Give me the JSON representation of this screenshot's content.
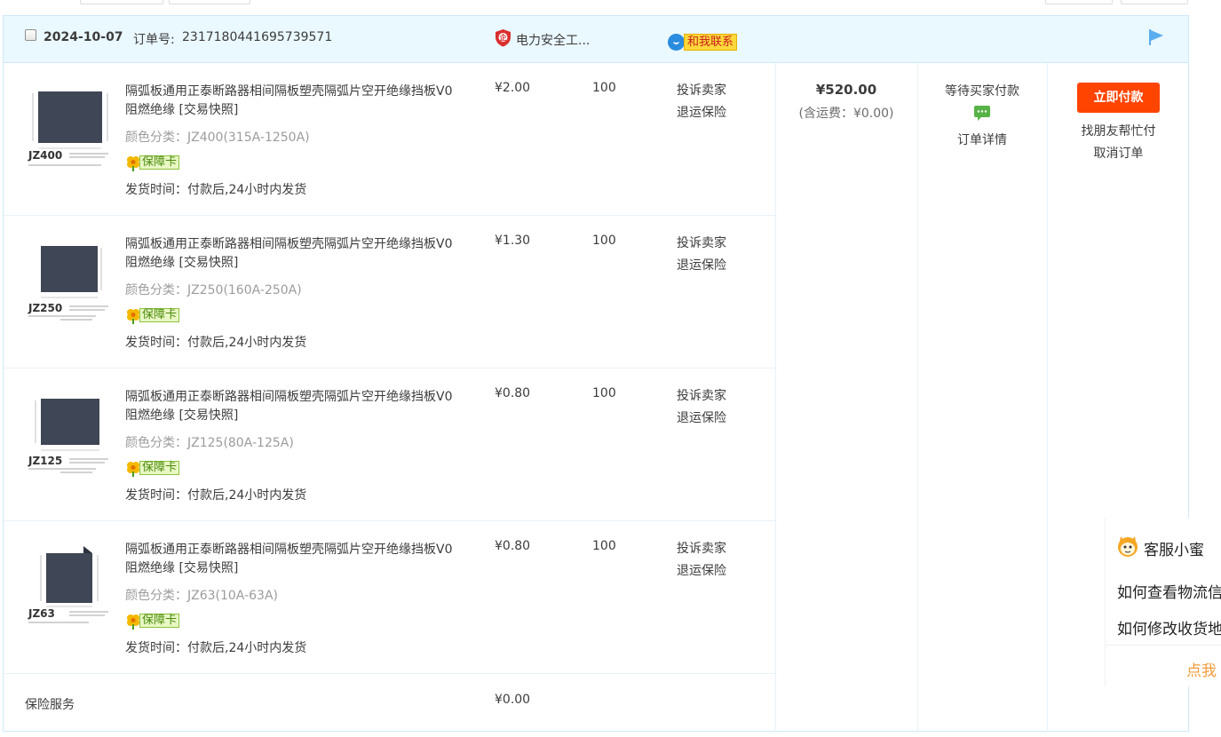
{
  "order": {
    "date": "2024-10-07",
    "order_no_label": "订单号:",
    "order_no": "2317180441695739571",
    "shop_name": "电力安全工...",
    "contact_label": "和我联系"
  },
  "items": [
    {
      "title": "隔弧板通用正泰断路器相间隔板塑壳隔弧片空开绝缘挡板V0阻燃绝缘 [交易快照]",
      "spec": "颜色分类：JZ400(315A-1250A)",
      "thumb_label": "JZ400",
      "badge": "保障卡",
      "ship": "发货时间：付款后,24小时内发货",
      "price": "¥2.00",
      "qty": "100",
      "op1": "投诉卖家",
      "op2": "退运保险"
    },
    {
      "title": "隔弧板通用正泰断路器相间隔板塑壳隔弧片空开绝缘挡板V0阻燃绝缘 [交易快照]",
      "spec": "颜色分类：JZ250(160A-250A)",
      "thumb_label": "JZ250",
      "badge": "保障卡",
      "ship": "发货时间：付款后,24小时内发货",
      "price": "¥1.30",
      "qty": "100",
      "op1": "投诉卖家",
      "op2": "退运保险"
    },
    {
      "title": "隔弧板通用正泰断路器相间隔板塑壳隔弧片空开绝缘挡板V0阻燃绝缘 [交易快照]",
      "spec": "颜色分类：JZ125(80A-125A)",
      "thumb_label": "JZ125",
      "badge": "保障卡",
      "ship": "发货时间：付款后,24小时内发货",
      "price": "¥0.80",
      "qty": "100",
      "op1": "投诉卖家",
      "op2": "退运保险"
    },
    {
      "title": "隔弧板通用正泰断路器相间隔板塑壳隔弧片空开绝缘挡板V0阻燃绝缘 [交易快照]",
      "spec": "颜色分类：JZ63(10A-63A)",
      "thumb_label": "JZ63",
      "badge": "保障卡",
      "ship": "发货时间：付款后,24小时内发货",
      "price": "¥0.80",
      "qty": "100",
      "op1": "投诉卖家",
      "op2": "退运保险"
    }
  ],
  "insurance": {
    "label": "保险服务",
    "price": "¥0.00"
  },
  "summary": {
    "total": "¥520.00",
    "freight": "(含运费：¥0.00)"
  },
  "status": {
    "text": "等待买家付款",
    "detail_link": "订单详情"
  },
  "actions": {
    "pay_label": "立即付款",
    "friend_pay": "找朋友帮忙付",
    "cancel": "取消订单"
  },
  "customer_service": {
    "title": "客服小蜜",
    "q1": "如何查看物流信",
    "q2": "如何修改收货地",
    "more": "点我"
  },
  "colors": {
    "header_bg": "#eaf8ff",
    "border": "#cfe8f7",
    "pay_button": "#ff4400",
    "contact_badge": "#ffd83b",
    "guarantee_badge": "#e8f7c4"
  }
}
